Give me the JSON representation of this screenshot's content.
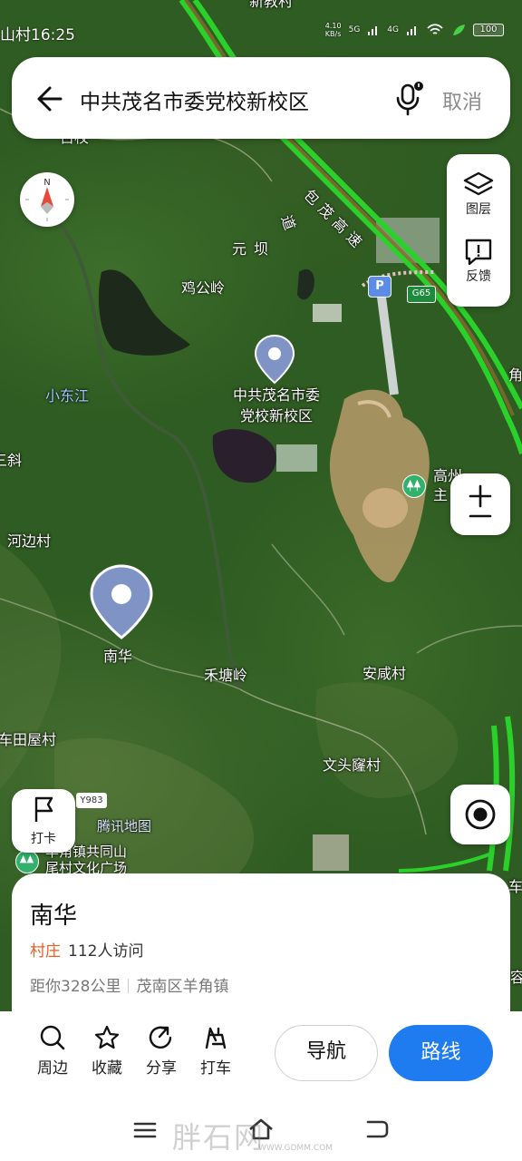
{
  "status_bar": {
    "left_text": "山村",
    "time": "16:25",
    "net_speed_value": "4.10",
    "net_speed_unit": "KB/s",
    "signal_1_label": "5G",
    "signal_2_label": "4G",
    "battery": "100"
  },
  "search": {
    "query": "中共茂名市委党校新校区",
    "cancel_label": "取消"
  },
  "map": {
    "labels": {
      "top_edge": "新教村",
      "top_left": "古校",
      "highway": "包茂高速",
      "road": "道",
      "yuanba": "元坝",
      "jigongling": "鸡公岭",
      "river": "小东江",
      "left_edge_1": "三斜",
      "right_edge_1": "角",
      "hebiancun": "河边村",
      "nanhua": "南华",
      "hetangling": "禾塘岭",
      "anxiancun": "安咸村",
      "chetianwucun": "车田屋村",
      "wentoulongcun": "文头窿村",
      "gaozhou": "高州",
      "gaozhou_2": "主",
      "road_code": "Y983",
      "brand": "腾讯地图",
      "bottom_poi_1": "羊角镇共同山",
      "bottom_poi_2": "尾村文化广场",
      "right_edge_2": "车",
      "right_edge_3": "容",
      "g65": "G65",
      "parking": "P"
    },
    "poi_name_line1": "中共茂名市委",
    "poi_name_line2": "党校新校区",
    "selected_name": "南华"
  },
  "controls": {
    "layers_label": "图层",
    "feedback_label": "反馈",
    "checkin_label": "打卡"
  },
  "place": {
    "name": "南华",
    "type": "村庄",
    "visits": "112人访问",
    "distance": "距你328公里",
    "region": "茂南区羊角镇"
  },
  "actions": {
    "nearby": "周边",
    "favorite": "收藏",
    "share": "分享",
    "taxi": "打车",
    "navigate": "导航",
    "route": "路线"
  },
  "watermark": {
    "main": "胖石网",
    "sub": "WWW.GDMM.COM"
  },
  "colors": {
    "route_button": "#1f7cf0",
    "category_text": "#f05a1e",
    "highway": "#2bd12b",
    "pin": "#7f93c4"
  }
}
